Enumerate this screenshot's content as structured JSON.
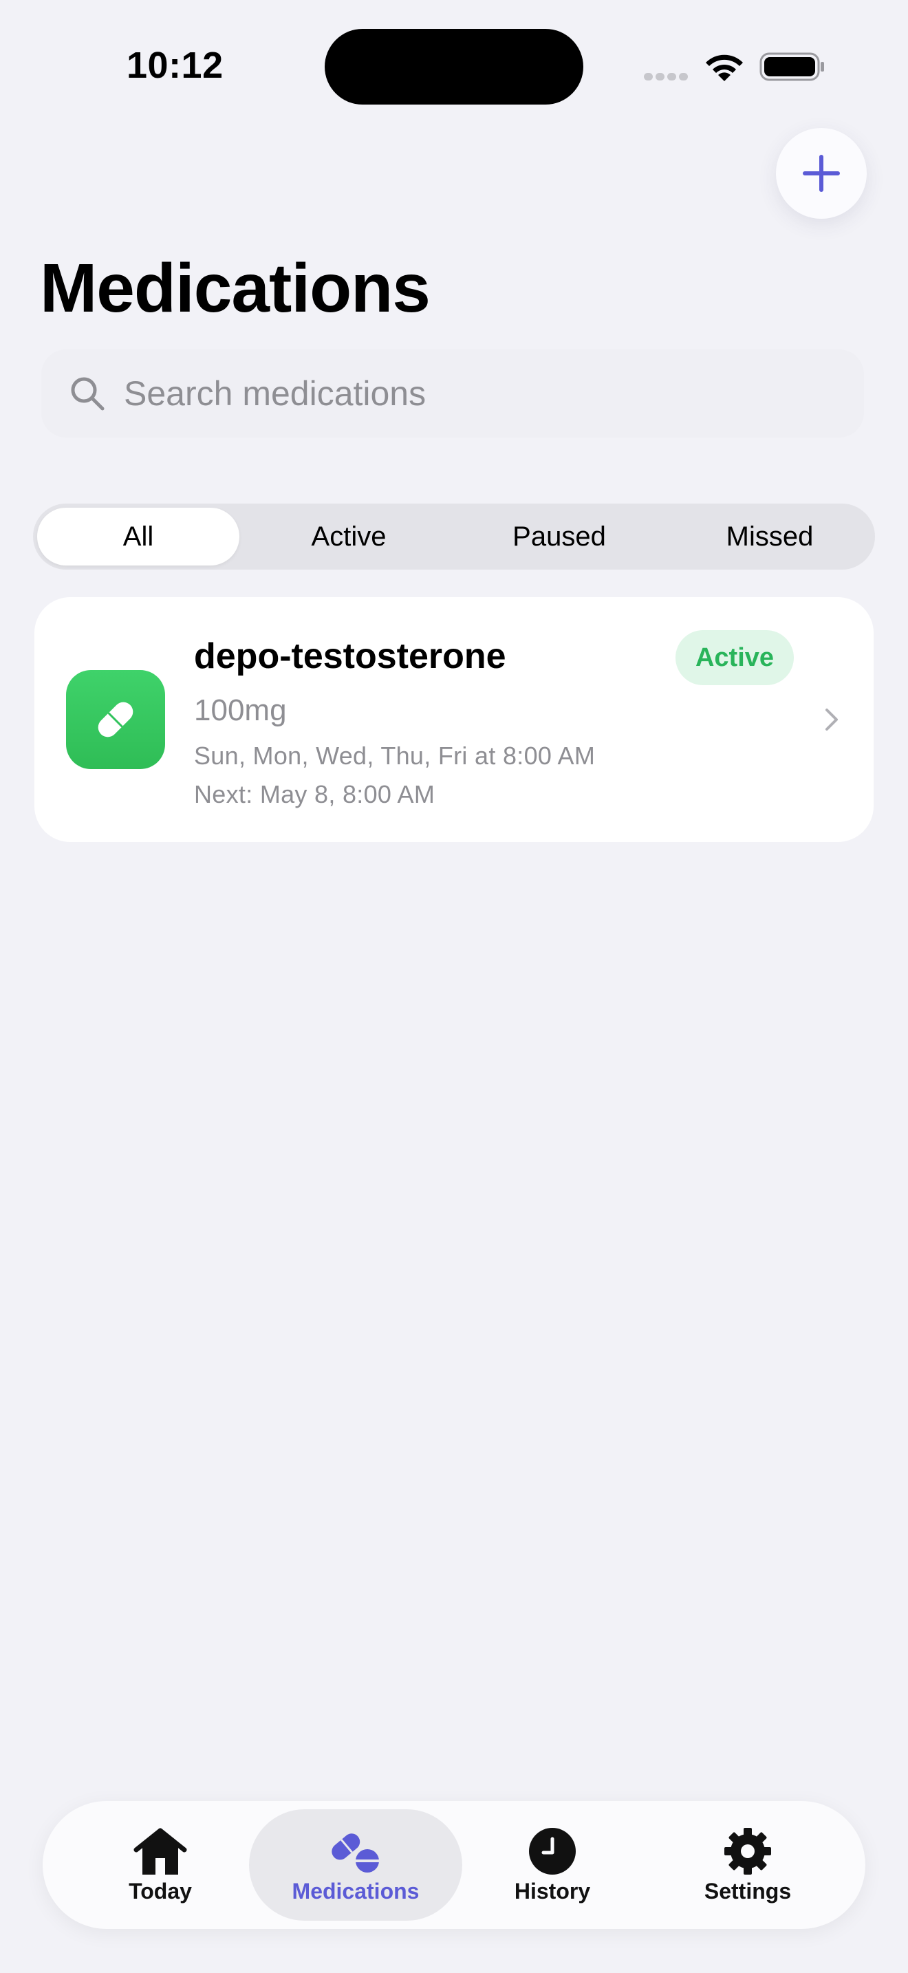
{
  "status_bar": {
    "time": "10:12"
  },
  "header": {
    "title": "Medications",
    "add_icon": "plus-icon"
  },
  "search": {
    "placeholder": "Search medications"
  },
  "filters": {
    "tabs": [
      {
        "label": "All",
        "selected": true
      },
      {
        "label": "Active",
        "selected": false
      },
      {
        "label": "Paused",
        "selected": false
      },
      {
        "label": "Missed",
        "selected": false
      }
    ]
  },
  "medications": [
    {
      "name": "depo-testosterone",
      "status": "Active",
      "dose": "100mg",
      "schedule": "Sun, Mon, Wed, Thu, Fri at 8:00 AM",
      "next": "Next: May 8, 8:00 AM",
      "icon": "pill-icon",
      "icon_color": "#34c759",
      "status_color": "#29b45a"
    }
  ],
  "tab_bar": {
    "items": [
      {
        "label": "Today",
        "icon": "house-icon",
        "selected": false
      },
      {
        "label": "Medications",
        "icon": "pills-icon",
        "selected": true
      },
      {
        "label": "History",
        "icon": "clock-icon",
        "selected": false
      },
      {
        "label": "Settings",
        "icon": "gear-icon",
        "selected": false
      }
    ]
  },
  "colors": {
    "accent": "#5b5bd6",
    "background": "#f2f2f7"
  }
}
